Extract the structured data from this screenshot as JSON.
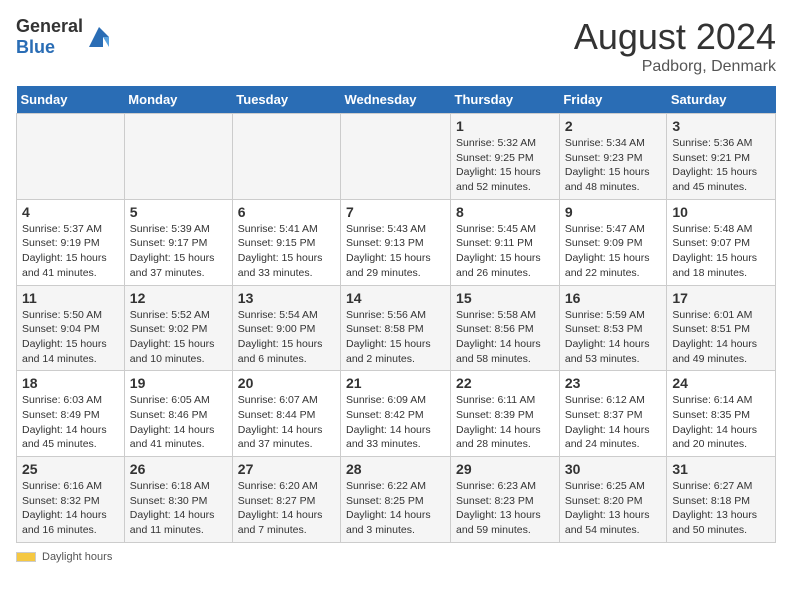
{
  "header": {
    "logo": {
      "general": "General",
      "blue": "Blue"
    },
    "month_year": "August 2024",
    "location": "Padborg, Denmark"
  },
  "days_of_week": [
    "Sunday",
    "Monday",
    "Tuesday",
    "Wednesday",
    "Thursday",
    "Friday",
    "Saturday"
  ],
  "weeks": [
    [
      {
        "day": "",
        "info": ""
      },
      {
        "day": "",
        "info": ""
      },
      {
        "day": "",
        "info": ""
      },
      {
        "day": "",
        "info": ""
      },
      {
        "day": "1",
        "info": "Sunrise: 5:32 AM\nSunset: 9:25 PM\nDaylight: 15 hours and 52 minutes."
      },
      {
        "day": "2",
        "info": "Sunrise: 5:34 AM\nSunset: 9:23 PM\nDaylight: 15 hours and 48 minutes."
      },
      {
        "day": "3",
        "info": "Sunrise: 5:36 AM\nSunset: 9:21 PM\nDaylight: 15 hours and 45 minutes."
      }
    ],
    [
      {
        "day": "4",
        "info": "Sunrise: 5:37 AM\nSunset: 9:19 PM\nDaylight: 15 hours and 41 minutes."
      },
      {
        "day": "5",
        "info": "Sunrise: 5:39 AM\nSunset: 9:17 PM\nDaylight: 15 hours and 37 minutes."
      },
      {
        "day": "6",
        "info": "Sunrise: 5:41 AM\nSunset: 9:15 PM\nDaylight: 15 hours and 33 minutes."
      },
      {
        "day": "7",
        "info": "Sunrise: 5:43 AM\nSunset: 9:13 PM\nDaylight: 15 hours and 29 minutes."
      },
      {
        "day": "8",
        "info": "Sunrise: 5:45 AM\nSunset: 9:11 PM\nDaylight: 15 hours and 26 minutes."
      },
      {
        "day": "9",
        "info": "Sunrise: 5:47 AM\nSunset: 9:09 PM\nDaylight: 15 hours and 22 minutes."
      },
      {
        "day": "10",
        "info": "Sunrise: 5:48 AM\nSunset: 9:07 PM\nDaylight: 15 hours and 18 minutes."
      }
    ],
    [
      {
        "day": "11",
        "info": "Sunrise: 5:50 AM\nSunset: 9:04 PM\nDaylight: 15 hours and 14 minutes."
      },
      {
        "day": "12",
        "info": "Sunrise: 5:52 AM\nSunset: 9:02 PM\nDaylight: 15 hours and 10 minutes."
      },
      {
        "day": "13",
        "info": "Sunrise: 5:54 AM\nSunset: 9:00 PM\nDaylight: 15 hours and 6 minutes."
      },
      {
        "day": "14",
        "info": "Sunrise: 5:56 AM\nSunset: 8:58 PM\nDaylight: 15 hours and 2 minutes."
      },
      {
        "day": "15",
        "info": "Sunrise: 5:58 AM\nSunset: 8:56 PM\nDaylight: 14 hours and 58 minutes."
      },
      {
        "day": "16",
        "info": "Sunrise: 5:59 AM\nSunset: 8:53 PM\nDaylight: 14 hours and 53 minutes."
      },
      {
        "day": "17",
        "info": "Sunrise: 6:01 AM\nSunset: 8:51 PM\nDaylight: 14 hours and 49 minutes."
      }
    ],
    [
      {
        "day": "18",
        "info": "Sunrise: 6:03 AM\nSunset: 8:49 PM\nDaylight: 14 hours and 45 minutes."
      },
      {
        "day": "19",
        "info": "Sunrise: 6:05 AM\nSunset: 8:46 PM\nDaylight: 14 hours and 41 minutes."
      },
      {
        "day": "20",
        "info": "Sunrise: 6:07 AM\nSunset: 8:44 PM\nDaylight: 14 hours and 37 minutes."
      },
      {
        "day": "21",
        "info": "Sunrise: 6:09 AM\nSunset: 8:42 PM\nDaylight: 14 hours and 33 minutes."
      },
      {
        "day": "22",
        "info": "Sunrise: 6:11 AM\nSunset: 8:39 PM\nDaylight: 14 hours and 28 minutes."
      },
      {
        "day": "23",
        "info": "Sunrise: 6:12 AM\nSunset: 8:37 PM\nDaylight: 14 hours and 24 minutes."
      },
      {
        "day": "24",
        "info": "Sunrise: 6:14 AM\nSunset: 8:35 PM\nDaylight: 14 hours and 20 minutes."
      }
    ],
    [
      {
        "day": "25",
        "info": "Sunrise: 6:16 AM\nSunset: 8:32 PM\nDaylight: 14 hours and 16 minutes."
      },
      {
        "day": "26",
        "info": "Sunrise: 6:18 AM\nSunset: 8:30 PM\nDaylight: 14 hours and 11 minutes."
      },
      {
        "day": "27",
        "info": "Sunrise: 6:20 AM\nSunset: 8:27 PM\nDaylight: 14 hours and 7 minutes."
      },
      {
        "day": "28",
        "info": "Sunrise: 6:22 AM\nSunset: 8:25 PM\nDaylight: 14 hours and 3 minutes."
      },
      {
        "day": "29",
        "info": "Sunrise: 6:23 AM\nSunset: 8:23 PM\nDaylight: 13 hours and 59 minutes."
      },
      {
        "day": "30",
        "info": "Sunrise: 6:25 AM\nSunset: 8:20 PM\nDaylight: 13 hours and 54 minutes."
      },
      {
        "day": "31",
        "info": "Sunrise: 6:27 AM\nSunset: 8:18 PM\nDaylight: 13 hours and 50 minutes."
      }
    ]
  ],
  "footer": {
    "daylight_label": "Daylight hours"
  }
}
